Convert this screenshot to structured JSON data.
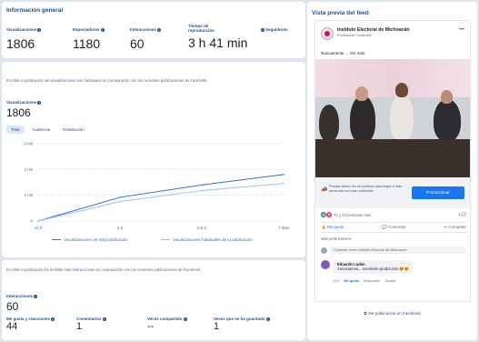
{
  "overview": {
    "title": "Información general",
    "metrics": [
      {
        "label": "Visualizaciones",
        "value": "1806"
      },
      {
        "label": "Espectadores",
        "value": "1180"
      },
      {
        "label": "Interacciones",
        "value": "60"
      },
      {
        "label": "Tiempo de reproducción",
        "value": "3 h 41 min"
      },
      {
        "label": "Seguidores",
        "value": ""
      }
    ]
  },
  "views": {
    "note": "En total el publicación las visualizaciones son habituales en comparación con tus recientes publicaciones de Facebook.",
    "label": "Visualizaciones",
    "value": "1806",
    "tabs": [
      "Total",
      "Audiencia",
      "Distribución"
    ]
  },
  "chart_data": {
    "type": "line",
    "x": [
      "12 h",
      "2 d",
      "3,5 d",
      "7 días"
    ],
    "series": [
      {
        "name": "Visualizaciones de esta publicación",
        "color": "#2f6fd6",
        "values": [
          0,
          920,
          1400,
          1806
        ]
      },
      {
        "name": "Visualizaciones habituales de tu publicación",
        "color": "#9dbff0",
        "values": [
          0,
          760,
          1180,
          1460
        ]
      }
    ],
    "yticks": [
      "0",
      "1 mil",
      "2 mil",
      "3 mil"
    ],
    "ylim": [
      0,
      3000
    ]
  },
  "interactions": {
    "note": "En total el publicación ha recibido más interacciones en comparación con tus recientes publicaciones de Facebook.",
    "label": "Interacciones",
    "value": "60",
    "sub": [
      {
        "label": "Me gusta y reacciones",
        "value": "44"
      },
      {
        "label": "Comentarios",
        "value": "1"
      },
      {
        "label": "Veces compartido",
        "value": "--"
      },
      {
        "label": "Veces que se ha guardado",
        "value": "1"
      }
    ]
  },
  "preview": {
    "title": "Vista previa del feed",
    "page_name": "Instituto Electoral de Michoacán",
    "meta": "Publicación Contenido",
    "desc": "Nuevamente ... Ver más",
    "cta_text": "Puedes hacer clic en publicar para llegar a más personas con este contenido",
    "cta_button": "Promocionar",
    "reactions_count": "Tú y 43 personas más",
    "comments_count": "1",
    "shares_count": "",
    "like_label": "Me gusta",
    "comment_label": "Comentar",
    "share_label": "Compartir",
    "relevant": "Más pertinentes ▾",
    "comment_placeholder": "Comenta como Instituto Electoral de Michoacán",
    "comment_author": "Eduardo Luden",
    "comment_text": "Anunciamos... excelente producción 😍😍",
    "comment_time": "13 h",
    "comment_like": "Me gusta",
    "comment_reply": "Responder",
    "comment_hide": "Ocultar",
    "view_on_fb": "Ver publicación en Facebook"
  }
}
